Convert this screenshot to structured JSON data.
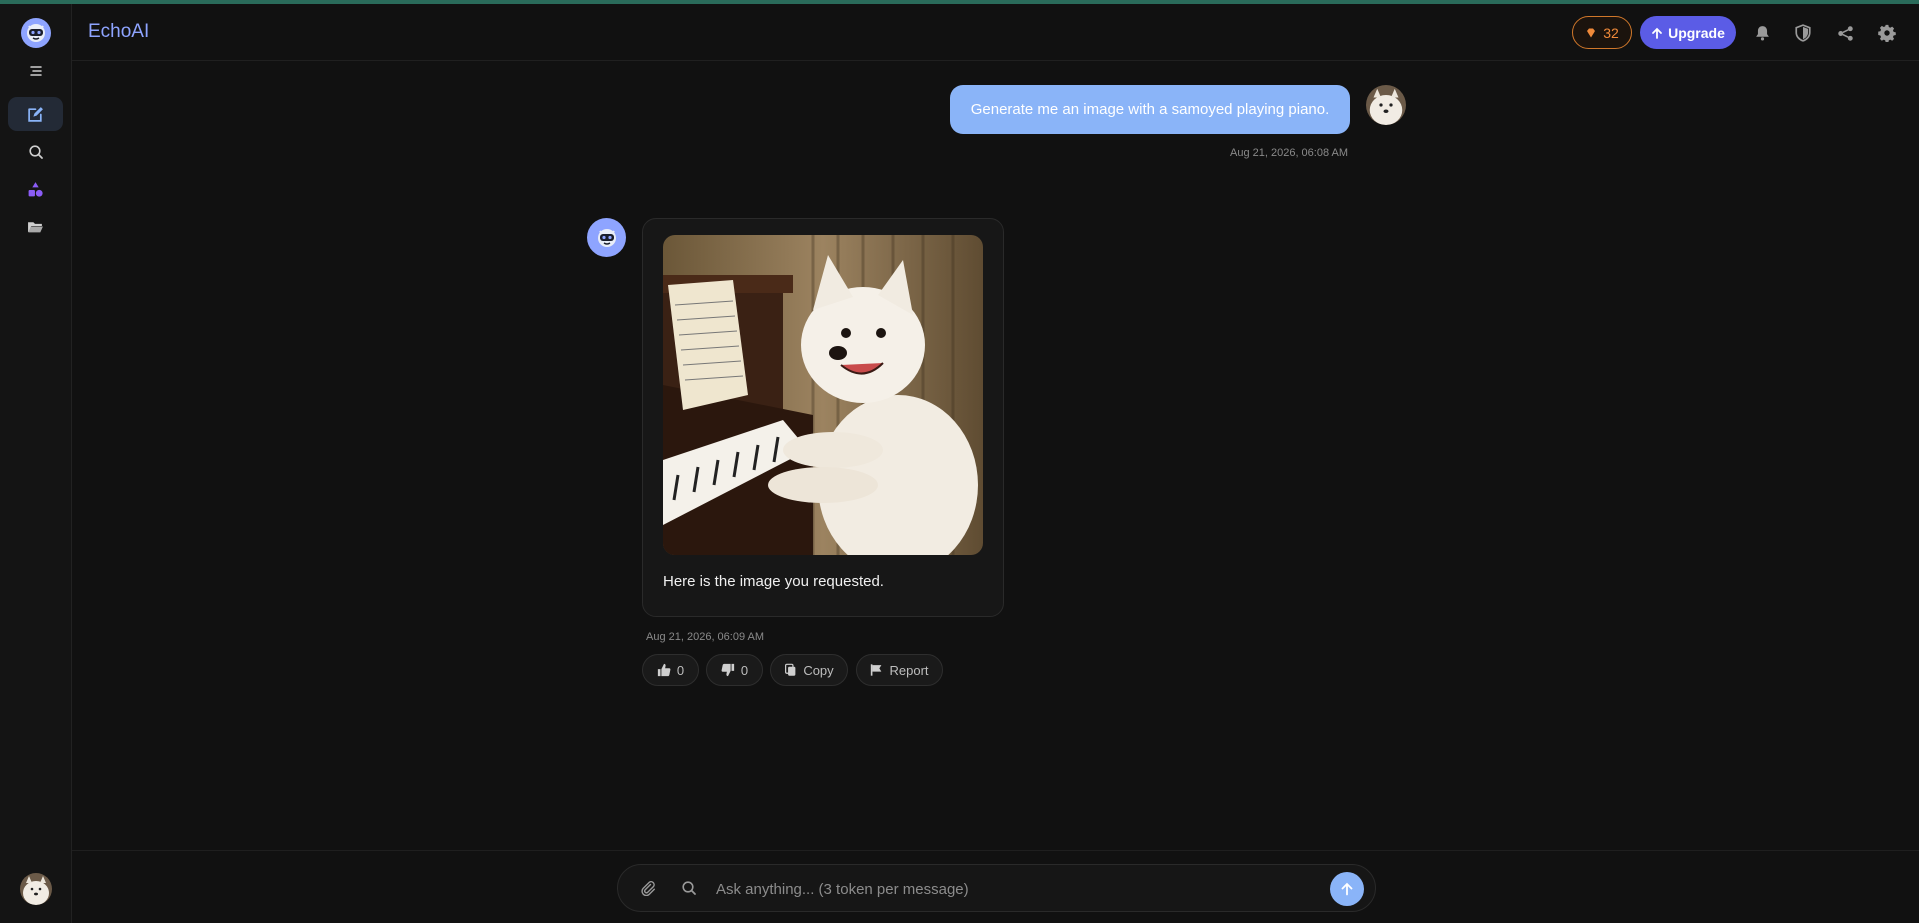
{
  "app": {
    "brand": "EchoAI"
  },
  "header": {
    "tokens_count": "32",
    "upgrade_label": "Upgrade",
    "icons": [
      "bell-icon",
      "shield-icon",
      "share-icon",
      "gear-icon"
    ]
  },
  "sidebar": {
    "items": [
      {
        "name": "menu",
        "icon": "menu-icon"
      },
      {
        "name": "new-chat",
        "icon": "edit-icon",
        "active": true
      },
      {
        "name": "search",
        "icon": "search-icon"
      },
      {
        "name": "shapes",
        "icon": "shapes-icon"
      },
      {
        "name": "folder",
        "icon": "folder-icon"
      }
    ]
  },
  "chat": {
    "user_message": {
      "text": "Generate me an image with a samoyed playing piano.",
      "timestamp": "Aug 21, 2026, 06:08 AM"
    },
    "bot_message": {
      "text": "Here is the image you requested.",
      "timestamp": "Aug 21, 2026, 06:09 AM",
      "image_subject": "samoyed-playing-piano",
      "actions": {
        "like_count": "0",
        "dislike_count": "0",
        "copy_label": "Copy",
        "report_label": "Report"
      }
    }
  },
  "composer": {
    "placeholder": "Ask anything... (3 token per message)",
    "value": ""
  },
  "colors": {
    "accent": "#8ea4ff",
    "user_bubble": "#8ab4f8",
    "upgrade": "#5b5ce6",
    "tokens": "#f08a3a",
    "background": "#111111"
  }
}
